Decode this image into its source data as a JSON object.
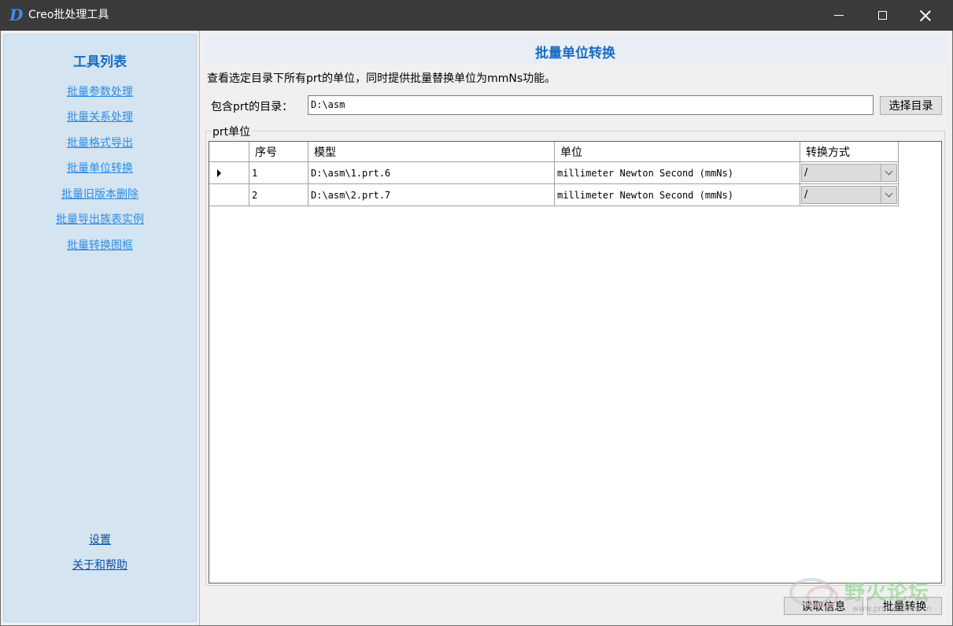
{
  "window": {
    "app_icon_glyph": "D",
    "title": "Creo批处理工具"
  },
  "sidebar": {
    "title": "工具列表",
    "links": [
      "批量参数处理",
      "批量关系处理",
      "批量格式导出",
      "批量单位转换",
      "批量旧版本删除",
      "批量导出族表实例",
      "批量转换图框"
    ],
    "settings": "设置",
    "about": "关于和帮助"
  },
  "main": {
    "title": "批量单位转换",
    "description": "查看选定目录下所有prt的单位，同时提供批量替换单位为mmNs功能。",
    "dir_label": "包含prt的目录：",
    "dir_value": "D:\\asm",
    "choose_button": "选择目录",
    "group_label": "prt单位",
    "table": {
      "headers": [
        "序号",
        "模型",
        "单位",
        "转换方式"
      ],
      "rows": [
        {
          "index": "1",
          "model": "D:\\asm\\1.prt.6",
          "unit": "millimeter Newton Second (mmNs)",
          "method": "/"
        },
        {
          "index": "2",
          "model": "D:\\asm\\2.prt.7",
          "unit": "millimeter Newton Second (mmNs)",
          "method": "/"
        }
      ]
    },
    "read_button": "读取信息",
    "convert_button": "批量转换"
  },
  "watermark": {
    "text": "野火论坛",
    "sub": "www.proewildfire.cn"
  },
  "colors": {
    "accent": "#1a6cc2",
    "link": "#2b8de3",
    "sidebar_bg": "#d5e4f1",
    "titlebar_bg": "#3a3a3a"
  }
}
